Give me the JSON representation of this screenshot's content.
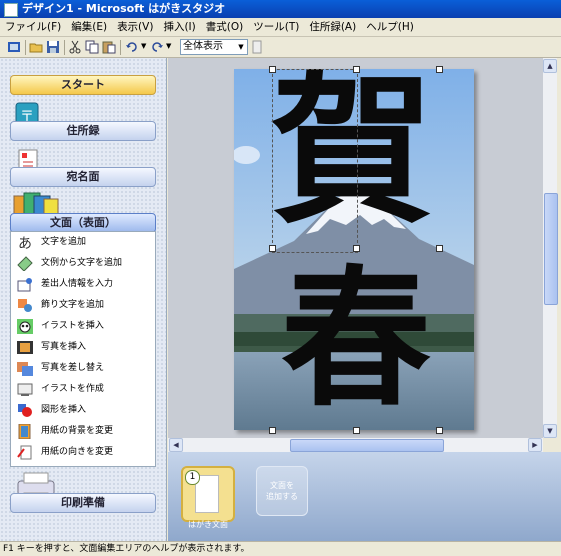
{
  "window": {
    "title": "デザイン1 - Microsoft はがきスタジオ"
  },
  "menu": [
    "ファイル(F)",
    "編集(E)",
    "表示(V)",
    "挿入(I)",
    "書式(O)",
    "ツール(T)",
    "住所録(A)",
    "ヘルプ(H)"
  ],
  "toolbar": {
    "zoom_value": "全体表示"
  },
  "sidebar": {
    "start_label": "スタート",
    "address_book_label": "住所録",
    "recipient_label": "宛名面",
    "front_label": "文面（表面）",
    "print_label": "印刷準備",
    "tasks": [
      {
        "label": "文字を追加",
        "icon": "text-a-icon"
      },
      {
        "label": "文例から文字を追加",
        "icon": "text-sample-icon"
      },
      {
        "label": "差出人情報を入力",
        "icon": "sender-info-icon"
      },
      {
        "label": "飾り文字を追加",
        "icon": "decorative-text-icon"
      },
      {
        "label": "イラストを挿入",
        "icon": "panda-illustration-icon"
      },
      {
        "label": "写真を挿入",
        "icon": "film-photo-icon"
      },
      {
        "label": "写真を差し替え",
        "icon": "replace-photo-icon"
      },
      {
        "label": "イラストを作成",
        "icon": "create-illustration-icon"
      },
      {
        "label": "図形を挿入",
        "icon": "shapes-icon"
      },
      {
        "label": "用紙の背景を変更",
        "icon": "paper-background-icon"
      },
      {
        "label": "用紙の向きを変更",
        "icon": "paper-orientation-icon"
      }
    ]
  },
  "canvas": {
    "greeting_char_1": "賀",
    "greeting_char_2": "春"
  },
  "thumbnails": {
    "page_number": "1",
    "page_label": "はがき文面",
    "add_label_1": "文面を",
    "add_label_2": "追加する"
  },
  "status": {
    "text": "F1 キーを押すと、文面編集エリアのヘルプが表示されます。"
  },
  "colors": {
    "title_bar": "#0a4cc8",
    "sky_top": "#7fb0e8",
    "lake": "#6d8aa0",
    "ink": "#0a0a0a",
    "start_button": "#f4c84a"
  }
}
